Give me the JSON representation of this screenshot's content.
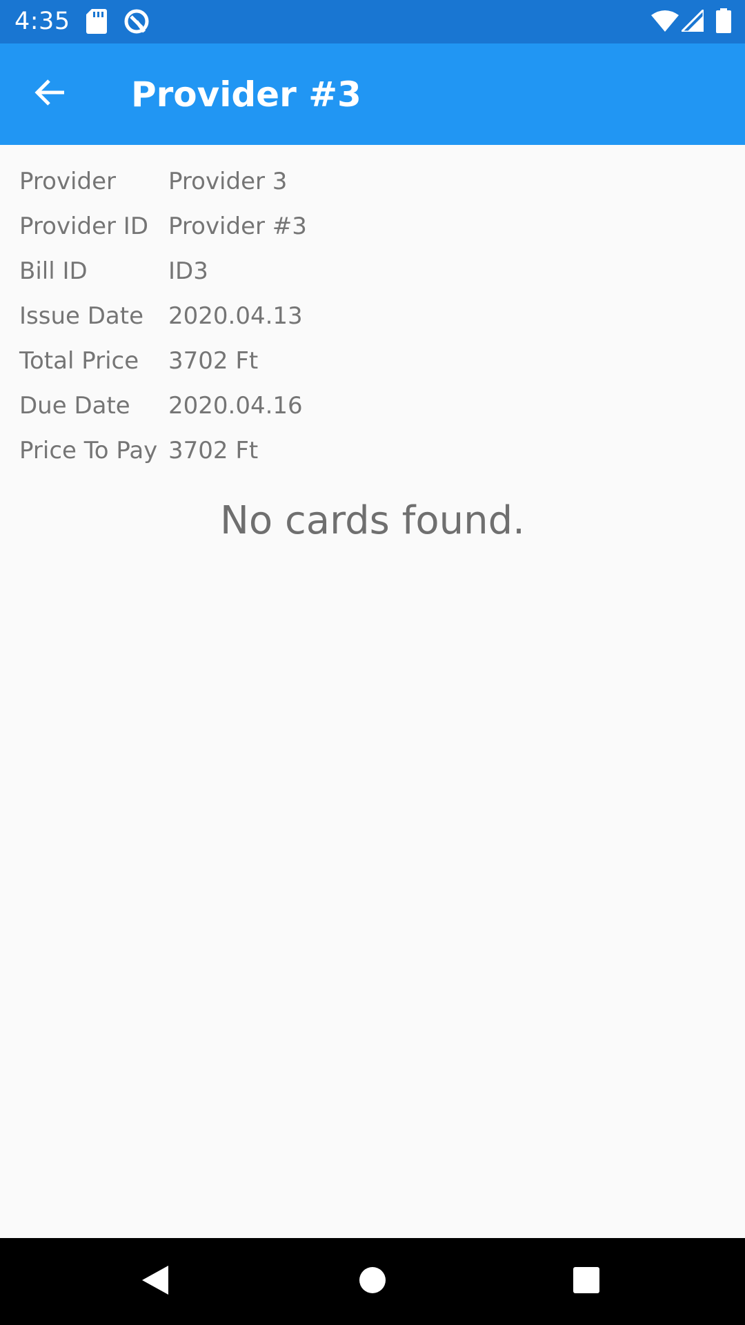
{
  "status_bar": {
    "time": "4:35",
    "icons": [
      "sd-card-icon",
      "sync-icon",
      "wifi-icon",
      "signal-icon",
      "battery-icon"
    ]
  },
  "app_bar": {
    "title": "Provider #3",
    "back_icon": "arrow-back-icon"
  },
  "details": [
    {
      "label": "Provider",
      "value": "Provider 3"
    },
    {
      "label": "Provider ID",
      "value": "Provider #3"
    },
    {
      "label": "Bill ID",
      "value": "ID3"
    },
    {
      "label": "Issue Date",
      "value": "2020.04.13"
    },
    {
      "label": "Total Price",
      "value": "3702 Ft"
    },
    {
      "label": "Due Date",
      "value": "2020.04.16"
    },
    {
      "label": "Price To Pay",
      "value": "3702 Ft"
    }
  ],
  "empty_message": "No cards found.",
  "nav_bar": {
    "icons": [
      "nav-back-icon",
      "nav-home-icon",
      "nav-recents-icon"
    ]
  },
  "colors": {
    "status_bar": "#1976d2",
    "app_bar": "#2196f3",
    "background": "#fafafa",
    "text_secondary": "#757575"
  }
}
